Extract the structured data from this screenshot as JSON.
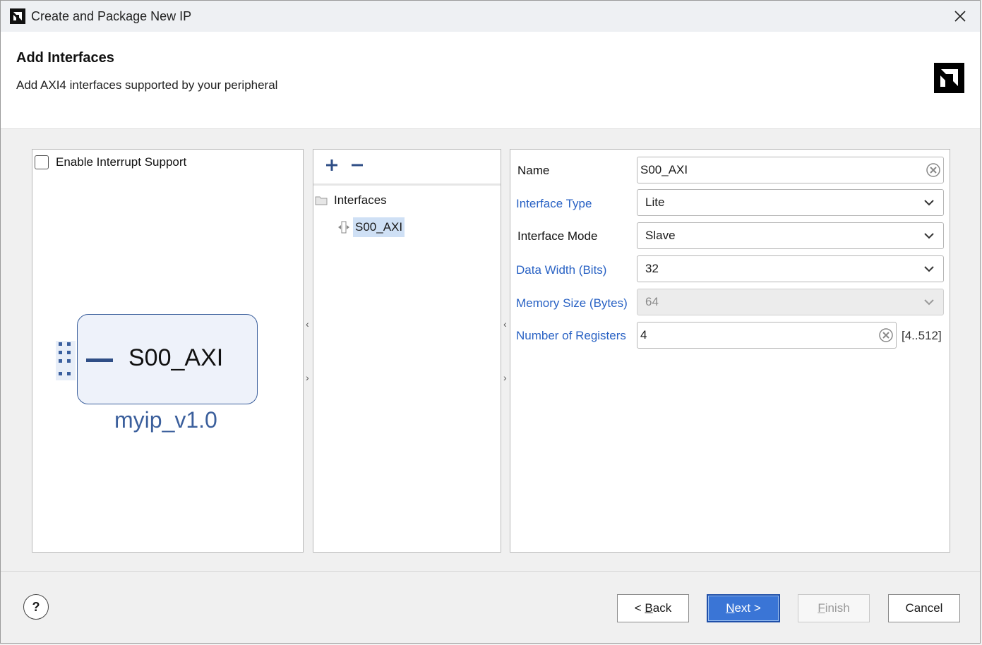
{
  "window": {
    "title": "Create and Package New IP"
  },
  "header": {
    "title": "Add Interfaces",
    "subtitle": "Add AXI4 interfaces supported by your peripheral"
  },
  "left_panel": {
    "interrupt_label": "Enable Interrupt Support",
    "interrupt_checked": false,
    "block_interface": "S00_AXI",
    "ip_name": "myip_v1.0"
  },
  "middle_panel": {
    "tree_root": "Interfaces",
    "tree_items": [
      "S00_AXI"
    ]
  },
  "properties": {
    "name": {
      "label": "Name",
      "value": "S00_AXI"
    },
    "interface_type": {
      "label": "Interface Type",
      "value": "Lite"
    },
    "interface_mode": {
      "label": "Interface Mode",
      "value": "Slave"
    },
    "data_width": {
      "label": "Data Width (Bits)",
      "value": "32"
    },
    "memory_size": {
      "label": "Memory Size (Bytes)",
      "value": "64"
    },
    "num_registers": {
      "label": "Number of Registers",
      "value": "4",
      "range": "[4..512]"
    }
  },
  "footer": {
    "help": "?",
    "back_prefix": "< ",
    "back_u": "B",
    "back_rest": "ack",
    "next_u": "N",
    "next_rest": "ext >",
    "finish_u": "F",
    "finish_rest": "inish",
    "cancel": "Cancel"
  },
  "colors": {
    "accent": "#3a75d6",
    "label_blue": "#2962c4",
    "block_border": "#3b5f9c"
  }
}
